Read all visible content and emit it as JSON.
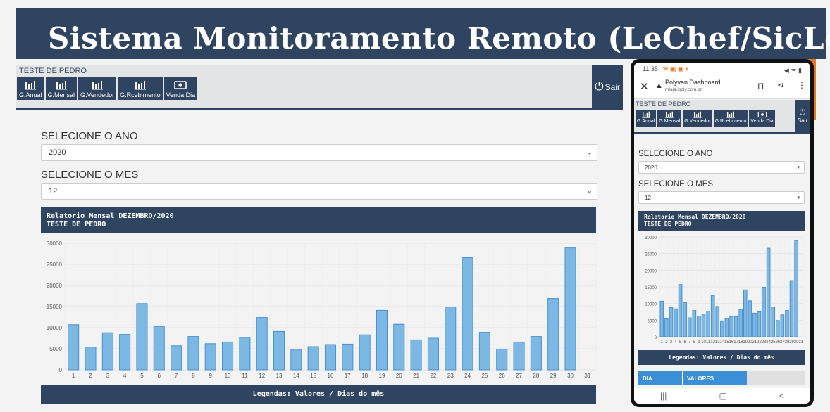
{
  "banner": {
    "title": "Sistema Monitoramento Remoto (LeChef/SicLoja)"
  },
  "desktop": {
    "user": "TESTE DE PEDRO",
    "nav": [
      {
        "label": "G.Anual",
        "icon": "bar-chart-icon"
      },
      {
        "label": "G.Mensal",
        "icon": "bar-chart-icon"
      },
      {
        "label": "G.Vendedor",
        "icon": "bar-chart-icon"
      },
      {
        "label": "G.Rcebimento",
        "icon": "bar-chart-icon"
      },
      {
        "label": "Venda Dia",
        "icon": "money-icon"
      }
    ],
    "sair_label": "Sair",
    "year_label": "SELECIONE O ANO",
    "year_value": "2020",
    "month_label": "SELECIONE O MES",
    "month_value": "12",
    "report_title": "Relatorio Mensal DEZEMBRO/2020",
    "report_subtitle": "TESTE DE PEDRO",
    "legend": "Legendas: Valores / Dias do mês"
  },
  "phone": {
    "time": "11:35",
    "status_icons": "⚒ ▣ ▣ •",
    "status_right": "◀ ᯤ ▮",
    "page_title": "Polyvan Dashboard",
    "url": "mloja.ipoly.com.br",
    "user": "TESTE DE PEDRO",
    "sair_label": "Sair",
    "year_label": "SELECIONE O ANO",
    "year_value": "2020",
    "month_label": "SELECIONE O MES",
    "month_value": "12",
    "report_title": "Relatorio Mensal DEZEMBRO/2020",
    "report_subtitle": "TESTE DE PEDRO",
    "legend": "Legendas: Valores / Dias do mês",
    "table_headers": [
      "DIA",
      "VALORES"
    ]
  },
  "colors": {
    "header": "#2e4460",
    "bar_fill": "#7cb8e4",
    "bar_stroke": "#4a90cc",
    "accent": "#3a8fd6",
    "orange": "#e8761f"
  },
  "chart_data": {
    "type": "bar",
    "categories": [
      "1",
      "2",
      "3",
      "4",
      "5",
      "6",
      "7",
      "8",
      "9",
      "10",
      "11",
      "12",
      "13",
      "14",
      "15",
      "16",
      "17",
      "18",
      "19",
      "20",
      "21",
      "22",
      "23",
      "24",
      "25",
      "26",
      "27",
      "28",
      "29",
      "30",
      "31"
    ],
    "values": [
      10700,
      5400,
      8800,
      8400,
      15700,
      10300,
      5700,
      7900,
      6200,
      6600,
      7700,
      12400,
      9100,
      4700,
      5500,
      6000,
      6100,
      8300,
      14100,
      10800,
      7100,
      7500,
      14900,
      26600,
      8900,
      4900,
      6600,
      7900,
      16900,
      28900
    ],
    "ylim": [
      0,
      30000
    ],
    "yticks": [
      0,
      5000,
      10000,
      15000,
      20000,
      25000,
      30000
    ],
    "grid": true
  }
}
